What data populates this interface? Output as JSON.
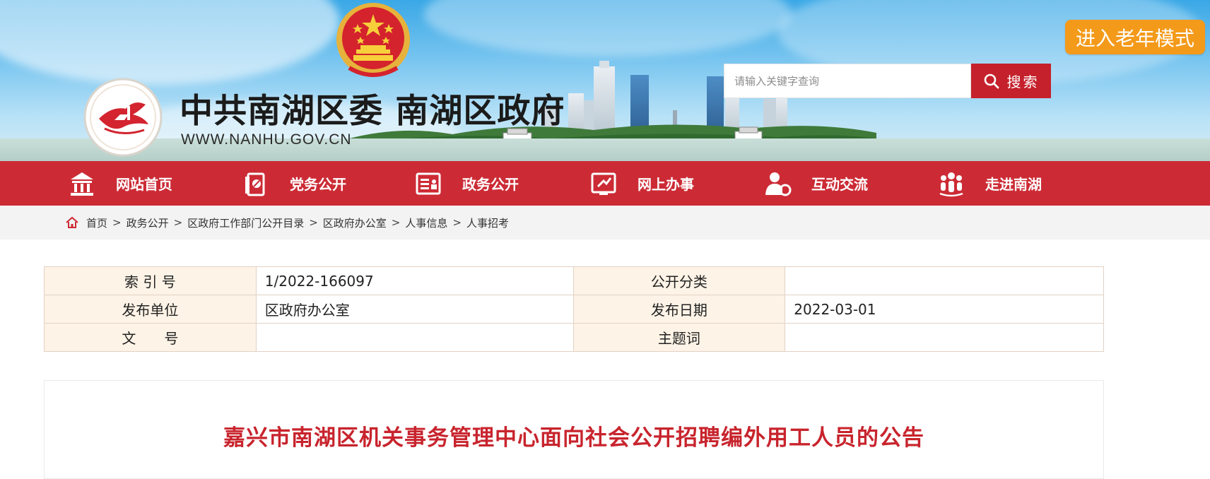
{
  "header": {
    "site_title": "中共南湖区委 南湖区政府",
    "site_url": "WWW.NANHU.GOV.CN",
    "search_placeholder": "请输入关键字查询",
    "search_label": "搜索",
    "elder_mode_label": "进入老年模式"
  },
  "nav": {
    "items": [
      {
        "label": "网站首页",
        "icon": "bank-icon"
      },
      {
        "label": "党务公开",
        "icon": "party-doc-icon"
      },
      {
        "label": "政务公开",
        "icon": "gov-doc-icon"
      },
      {
        "label": "网上办事",
        "icon": "online-service-icon"
      },
      {
        "label": "互动交流",
        "icon": "interaction-icon"
      },
      {
        "label": "走进南湖",
        "icon": "people-group-icon"
      }
    ]
  },
  "breadcrumb": {
    "items": [
      "首页",
      "政务公开",
      "区政府工作部门公开目录",
      "区政府办公室",
      "人事信息",
      "人事招考"
    ],
    "separator": ">"
  },
  "info": {
    "index_label": "索 引 号",
    "index_value": "1/2022-166097",
    "category_label": "公开分类",
    "category_value": "",
    "publisher_label": "发布单位",
    "publisher_value": "区政府办公室",
    "date_label": "发布日期",
    "date_value": "2022-03-01",
    "docno_label": "文　　号",
    "docno_value": "",
    "keyword_label": "主题词",
    "keyword_value": ""
  },
  "article": {
    "title": "嘉兴市南湖区机关事务管理中心面向社会公开招聘编外用工人员的公告"
  },
  "colors": {
    "nav_red": "#cc2b35",
    "title_red": "#c8242d",
    "elder_orange": "#f49a1a",
    "label_cell_bg": "#fdf3e6"
  }
}
